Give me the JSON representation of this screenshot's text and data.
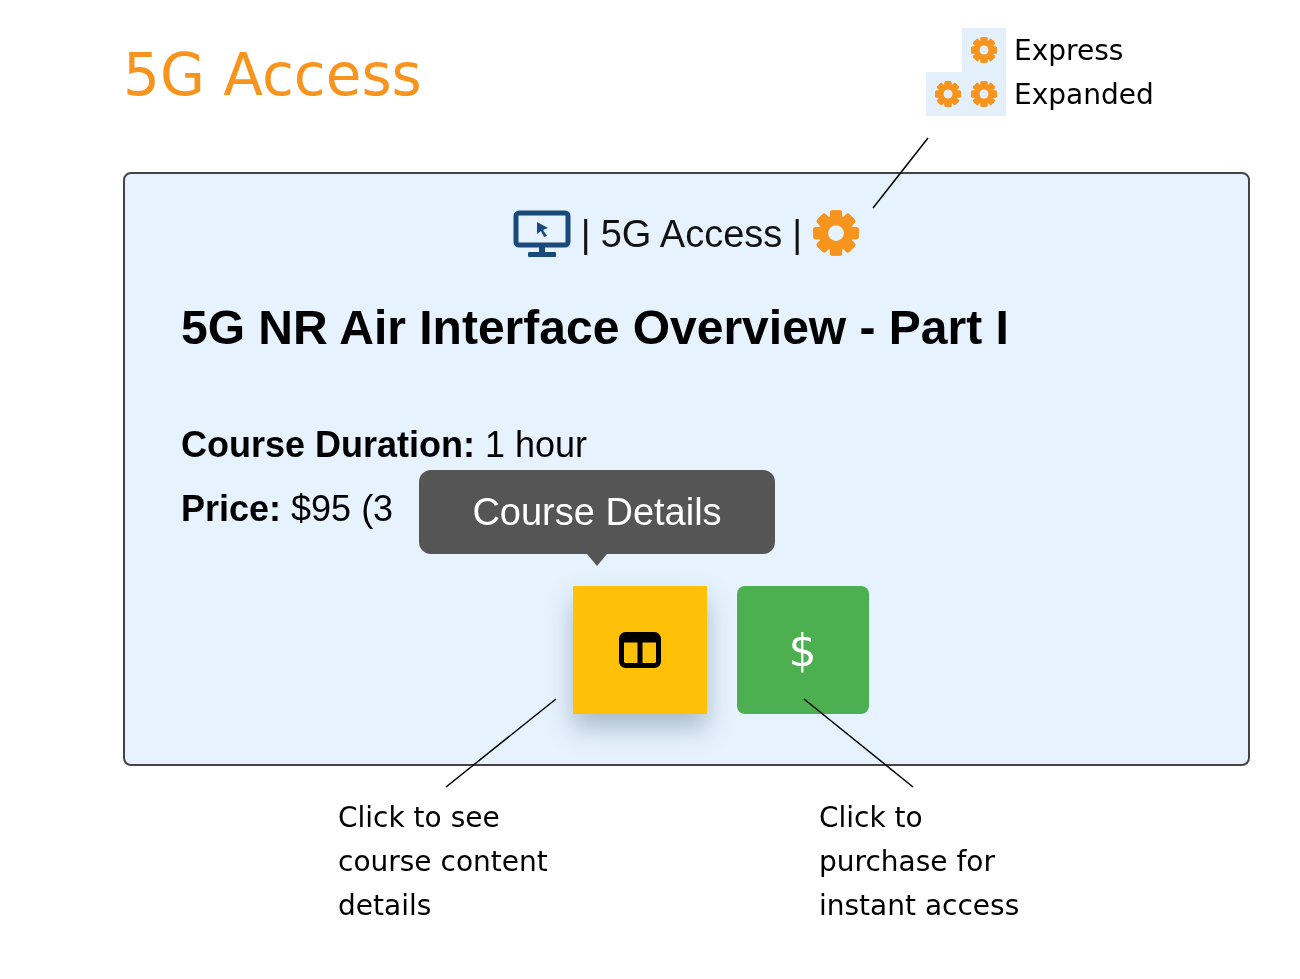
{
  "page_title": "5G Access",
  "legend": [
    {
      "kind": "express",
      "label": "Express"
    },
    {
      "kind": "expanded",
      "label": "Expanded"
    }
  ],
  "card": {
    "header": {
      "separator_1": "|",
      "category": "5G Access",
      "separator_2": "|",
      "badge": {
        "kind": "express"
      }
    },
    "title": "5G NR Air Interface Overview - Part I",
    "details": [
      {
        "label": "Course Duration:",
        "value": "1 hour"
      },
      {
        "label": "Price:",
        "value": "$95 (3"
      }
    ],
    "tooltip": "Course Details",
    "buttons": [
      {
        "kind": "details"
      },
      {
        "kind": "purchase",
        "label": "$"
      }
    ]
  },
  "annotations": [
    {
      "text": "Click to see\ncourse content\ndetails"
    },
    {
      "text": "Click to\npurchase for\ninstant access"
    }
  ]
}
